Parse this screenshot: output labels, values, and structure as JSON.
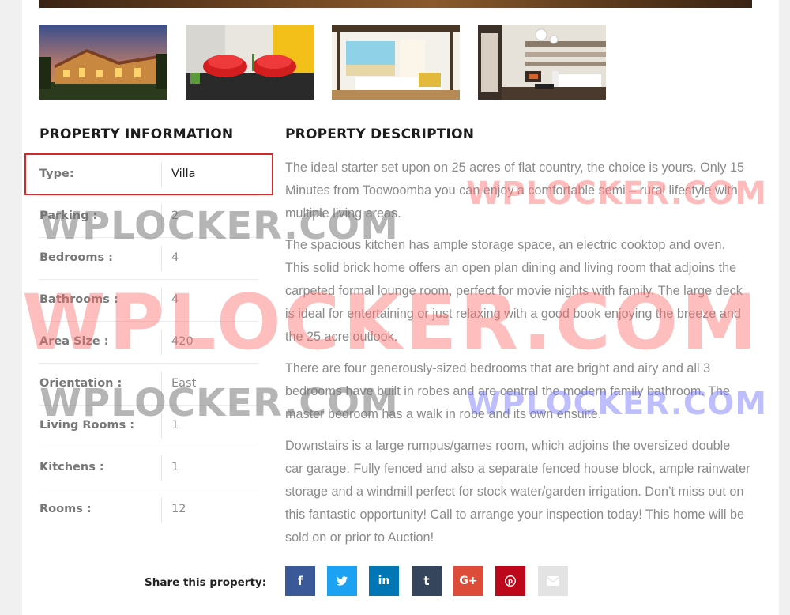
{
  "gallery": {
    "thumbnails": [
      {
        "icon": "villa-exterior-photo"
      },
      {
        "icon": "red-chairs-interior-photo"
      },
      {
        "icon": "canopy-bedroom-photo"
      },
      {
        "icon": "living-room-photo"
      }
    ]
  },
  "property_information": {
    "heading": "PROPERTY INFORMATION",
    "rows": [
      {
        "label": "Type:",
        "value": "Villa"
      },
      {
        "label": "Parking :",
        "value": "2"
      },
      {
        "label": "Bedrooms :",
        "value": "4"
      },
      {
        "label": "Bathrooms :",
        "value": "4"
      },
      {
        "label": "Area Size :",
        "value": "420"
      },
      {
        "label": "Orientation :",
        "value": "East"
      },
      {
        "label": "Living Rooms :",
        "value": "1"
      },
      {
        "label": "Kitchens :",
        "value": "1"
      },
      {
        "label": "Rooms :",
        "value": "12"
      }
    ],
    "highlight_color": "#d12a2a"
  },
  "property_description": {
    "heading": "PROPERTY DESCRIPTION",
    "paragraphs": [
      "The ideal starter set upon on 25 acres of flat country, the choice is yours. Only 15 Minutes from Toowoomba you can enjoy a comfortable semi – rural lifestyle with multiple living areas.",
      "The spacious kitchen has ample storage space, an electric cooktop and oven. This solid brick home offers an open plan dining and living room that adjoins the carpeted formal lounge room, perfect for movie nights with family. The large deck is ideal for entertaining or just relaxing with a good book enjoying the breeze and the 25 acre outlook.",
      "There are four generously-sized bedrooms that are bright and airy and all 3 bedrooms have built in robes and are central the modern family bathroom. The master bedroom has a walk in robe and its own ensuite.",
      "Downstairs is a large rumpus/games room, which adjoins the oversized double car garage. Fully fenced and also a separate fenced house block, ample rainwater storage and a windmill perfect for stock water/garden irrigation. Don’t miss out on this fantastic opportunity! Call to arrange your inspection today! This home will be sold on or prior to Auction!"
    ]
  },
  "share": {
    "label": "Share this property:",
    "buttons": [
      {
        "network": "facebook",
        "glyph": "f",
        "icon": "facebook-icon",
        "color": "#3b5998"
      },
      {
        "network": "twitter",
        "glyph": "🐦",
        "icon": "twitter-icon",
        "color": "#1da1f2"
      },
      {
        "network": "linkedin",
        "glyph": "in",
        "icon": "linkedin-icon",
        "color": "#0077b5"
      },
      {
        "network": "tumblr",
        "glyph": "t",
        "icon": "tumblr-icon",
        "color": "#35465c"
      },
      {
        "network": "google-plus",
        "glyph": "G+",
        "icon": "google-plus-icon",
        "color": "#dd4b39"
      },
      {
        "network": "pinterest",
        "glyph": "P",
        "icon": "pinterest-icon",
        "color": "#bd081c"
      },
      {
        "network": "email",
        "glyph": "✉",
        "icon": "email-icon",
        "color": "#e3e3e3"
      }
    ]
  },
  "watermarks": [
    "WPLOCKER.COM",
    "WPLOCKER.COM",
    "WPLOCKER.COM",
    "WPLOCKER.COM"
  ]
}
